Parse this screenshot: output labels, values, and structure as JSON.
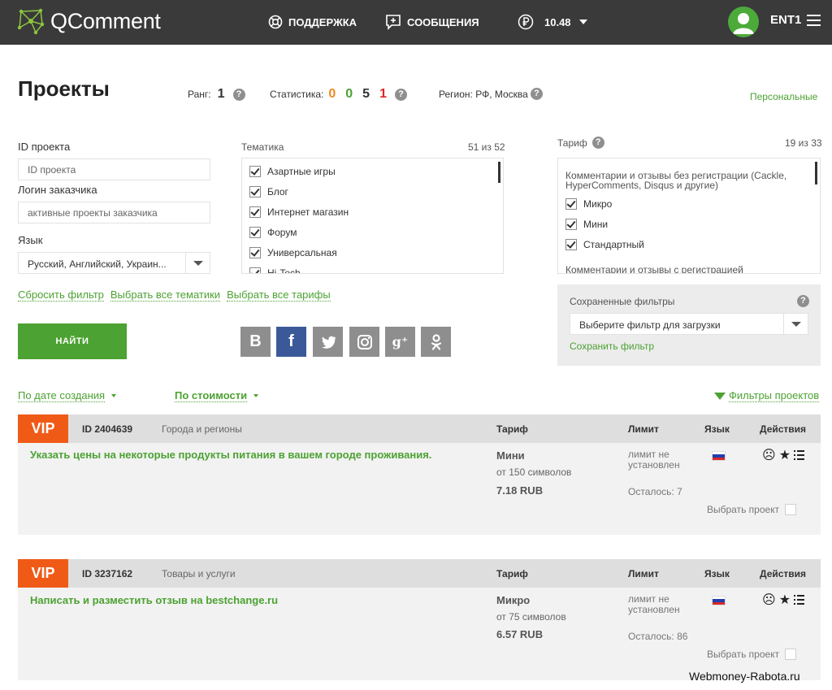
{
  "topbar": {
    "brand": "QComment",
    "support": "ПОДДЕРЖКА",
    "messages": "СООБЩЕНИЯ",
    "balance": "10.48",
    "username": "ENT1",
    "icons": [
      "network-logo-icon",
      "lifebuoy-icon",
      "chat-plus-icon",
      "ruble-icon",
      "user-avatar-icon",
      "hamburger-menu-icon"
    ]
  },
  "header": {
    "title": "Проекты",
    "rank_label": "Ранг:",
    "rank_value": "1",
    "stats_label": "Статистика:",
    "stats": [
      {
        "value": "0",
        "color": "#f08a24"
      },
      {
        "value": "0",
        "color": "#4ca232"
      },
      {
        "value": "5",
        "color": "#333333"
      },
      {
        "value": "1",
        "color": "#e02424"
      }
    ],
    "region": "Регион: РФ, Москва",
    "personal": "Персональные",
    "help": "?"
  },
  "filters": {
    "project_id_label": "ID проекта",
    "project_id_placeholder": "ID проекта",
    "customer_label": "Логин заказчика",
    "customer_placeholder": "активные проекты заказчика",
    "language_label": "Язык",
    "language_value": "Русский, Английский, Украин...",
    "topics_label": "Тематика",
    "topics_count": "51 из 52",
    "topics": [
      {
        "label": "Азартные игры",
        "checked": true
      },
      {
        "label": "Блог",
        "checked": true
      },
      {
        "label": "Интернет магазин",
        "checked": true
      },
      {
        "label": "Форум",
        "checked": true
      },
      {
        "label": "Универсальная",
        "checked": true
      },
      {
        "label": "Hi-Tech",
        "checked": true
      }
    ],
    "tariff_label": "Тариф",
    "tariff_count": "19 из 33",
    "tariff_group1": "Комментарии и отзывы без регистрации (Cackle, HyperComments, Disqus и другие)",
    "tariffs": [
      {
        "label": "Микро",
        "checked": true
      },
      {
        "label": "Мини",
        "checked": true
      },
      {
        "label": "Стандартный",
        "checked": true
      }
    ],
    "tariff_group2": "Комментарии и отзывы с регистрацией",
    "reset": "Сбросить фильтр",
    "select_topics": "Выбрать все тематики",
    "select_tariffs": "Выбрать все тарифы",
    "find": "НАЙТИ",
    "saved_title": "Сохраненные фильтры",
    "saved_placeholder": "Выберите фильтр для загрузки",
    "save_filter": "Сохранить фильтр"
  },
  "social": [
    {
      "icon": "vk-icon",
      "glyph": "В",
      "color": "#8e8e8e"
    },
    {
      "icon": "facebook-icon",
      "glyph": "f",
      "color": "#3b5998"
    },
    {
      "icon": "twitter-icon",
      "glyph": "🐦",
      "color": "#8e8e8e"
    },
    {
      "icon": "instagram-icon",
      "glyph": "◎",
      "color": "#8e8e8e"
    },
    {
      "icon": "google-plus-icon",
      "glyph": "g⁺",
      "color": "#8e8e8e"
    },
    {
      "icon": "odnoklassniki-icon",
      "glyph": "ꝏ",
      "color": "#8e8e8e"
    }
  ],
  "sort": {
    "by_date": "По дате создания",
    "by_price": "По стоимости",
    "project_filters": "Фильтры проектов"
  },
  "projects": [
    {
      "badge": "VIP",
      "id": "ID 2404639",
      "category": "Города и регионы",
      "col_tariff": "Тариф",
      "col_limit": "Лимит",
      "col_lang": "Язык",
      "col_actions": "Действия",
      "title": "Указать цены на некоторые продукты питания в вашем городе проживания.",
      "tariff": "Мини",
      "length": "от 150 символов",
      "price": "7.18 RUB",
      "limit": "лимит не установлен",
      "remaining": "Осталось: 7",
      "pick": "Выбрать проект"
    },
    {
      "badge": "VIP",
      "id": "ID 3237162",
      "category": "Товары и услуги",
      "col_tariff": "Тариф",
      "col_limit": "Лимит",
      "col_lang": "Язык",
      "col_actions": "Действия",
      "title": "Написать и разместить отзыв на bestchange.ru",
      "tariff": "Микро",
      "length": "от 75 символов",
      "price": "6.57 RUB",
      "limit": "лимит не установлен",
      "remaining": "Осталось: 86",
      "pick": "Выбрать проект"
    }
  ],
  "watermark": "Webmoney-Rabota.ru"
}
